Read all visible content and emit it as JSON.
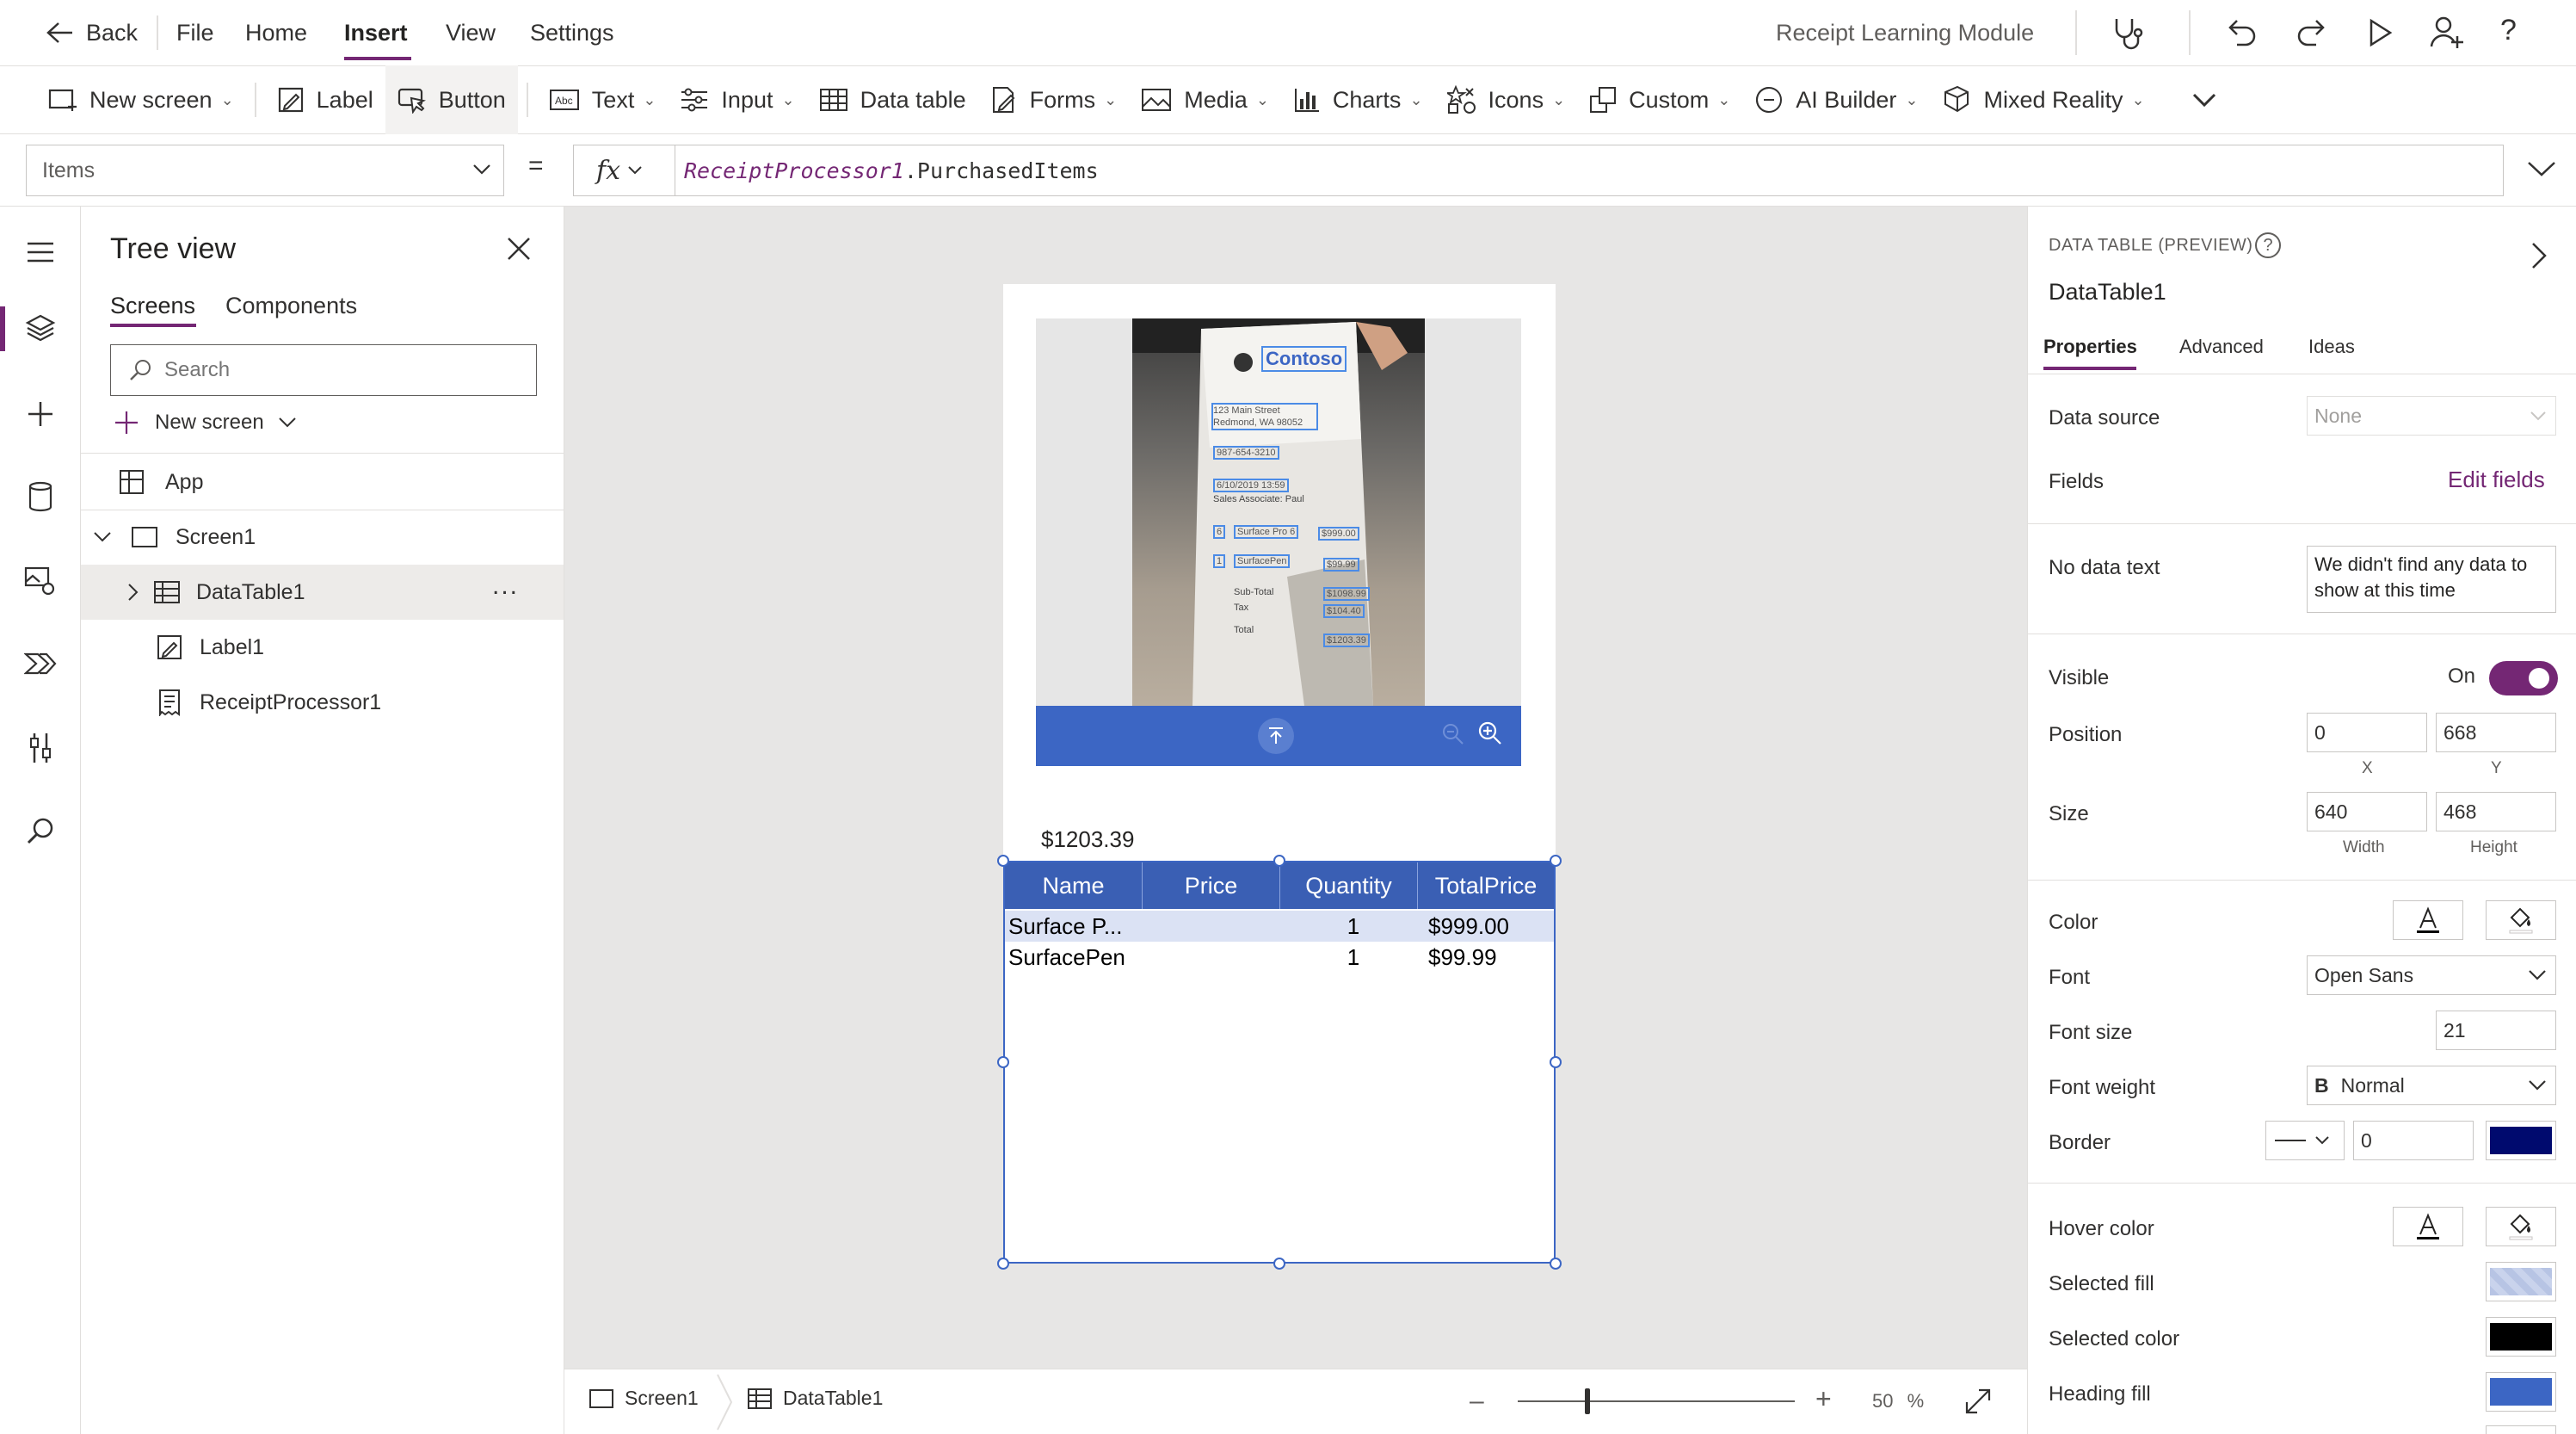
{
  "topbar": {
    "back_label": "Back",
    "menu": [
      "File",
      "Home",
      "Insert",
      "View",
      "Settings"
    ],
    "active_menu": "Insert",
    "app_title": "Receipt Learning Module"
  },
  "ribbon": {
    "new_screen": "New screen",
    "label": "Label",
    "button": "Button",
    "text": "Text",
    "input": "Input",
    "data_table": "Data table",
    "forms": "Forms",
    "media": "Media",
    "charts": "Charts",
    "icons": "Icons",
    "custom": "Custom",
    "ai_builder": "AI Builder",
    "mixed_reality": "Mixed Reality"
  },
  "formula": {
    "property": "Items",
    "equals": "=",
    "fx": "fx",
    "expression_object": "ReceiptProcessor1",
    "expression_rest": ".PurchasedItems"
  },
  "tree": {
    "title": "Tree view",
    "tabs": [
      "Screens",
      "Components"
    ],
    "search_placeholder": "Search",
    "new_screen": "New screen",
    "app": "App",
    "screen": "Screen1",
    "children": [
      "DataTable1",
      "Label1",
      "ReceiptProcessor1"
    ],
    "more": "..."
  },
  "canvas": {
    "total_label": "$1203.39",
    "table": {
      "headers": [
        "Name",
        "Price",
        "Quantity",
        "TotalPrice"
      ],
      "rows": [
        [
          "Surface P...",
          "",
          "1",
          "$999.00"
        ],
        [
          "SurfacePen",
          "",
          "1",
          "$99.99"
        ]
      ]
    },
    "receipt_text": {
      "brand": "Contoso",
      "addr1": "123 Main Street",
      "addr2": "Redmond, WA 98052",
      "phone": "987-654-3210",
      "date": "6/10/2019 13:59",
      "associate": "Sales Associate: Paul",
      "item1_qty": "6",
      "item1_name": "Surface Pro 6",
      "item1_price": "$999.00",
      "item2_qty": "1",
      "item2_name": "SurfacePen",
      "item2_price": "$99.99",
      "subtotal_label": "Sub-Total",
      "subtotal": "$1098.99",
      "tax_label": "Tax",
      "tax": "$104.40",
      "total_label": "Total",
      "total": "$1203.39"
    }
  },
  "statusbar": {
    "screen": "Screen1",
    "control": "DataTable1",
    "zoom_value": "50",
    "zoom_unit": "%",
    "zoom_fraction": 0.5
  },
  "props": {
    "section_title": "DATA TABLE (PREVIEW)",
    "control_name": "DataTable1",
    "tabs": [
      "Properties",
      "Advanced",
      "Ideas"
    ],
    "data_source_label": "Data source",
    "data_source_value": "None",
    "fields_label": "Fields",
    "edit_fields": "Edit fields",
    "no_data_label": "No data text",
    "no_data_value": "We didn't find any data to show at this time",
    "visible_label": "Visible",
    "visible_value": "On",
    "position_label": "Position",
    "x_value": "0",
    "y_value": "668",
    "x_caption": "X",
    "y_caption": "Y",
    "size_label": "Size",
    "width_value": "640",
    "height_value": "468",
    "width_caption": "Width",
    "height_caption": "Height",
    "color_label": "Color",
    "font_label": "Font",
    "font_value": "Open Sans",
    "font_size_label": "Font size",
    "font_size_value": "21",
    "font_weight_label": "Font weight",
    "font_weight_icon": "B",
    "font_weight_value": "Normal",
    "border_label": "Border",
    "border_value": "0",
    "hover_color_label": "Hover color",
    "selected_fill_label": "Selected fill",
    "selected_color_label": "Selected color",
    "heading_fill_label": "Heading fill",
    "colors": {
      "accent": "#742774",
      "table_header": "#3a5fb4",
      "border_color": "#000a6e",
      "selected_color": "#000000",
      "heading_fill": "#3c66c4"
    }
  }
}
